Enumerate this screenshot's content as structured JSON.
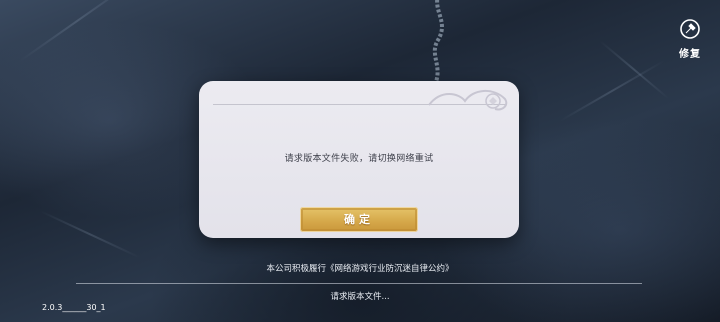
{
  "repair": {
    "label": "修复",
    "icon": "repair-icon"
  },
  "dialog": {
    "message": "请求版本文件失败，请切换网络重试",
    "confirm_label": "确定"
  },
  "footer": {
    "policy_text": "本公司积极履行《网络游戏行业防沉迷自律公约》",
    "status_text": "请求版本文件...",
    "version": "2.0.3______30_1"
  },
  "colors": {
    "dialog_bg": "#ecebf1",
    "button_gold": "#d6a94b",
    "message_text": "#3d3f4a"
  }
}
